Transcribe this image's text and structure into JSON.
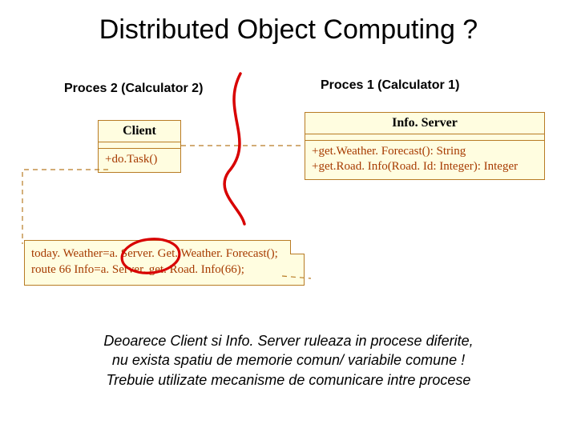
{
  "title": "Distributed Object Computing ?",
  "process2_label": "Proces 2 (Calculator 2)",
  "process1_label": "Proces 1 (Calculator 1)",
  "client": {
    "name": "Client",
    "op1": "+do.Task()"
  },
  "server": {
    "name": "Info. Server",
    "op1": "+get.Weather. Forecast(): String",
    "op2": "+get.Road. Info(Road. Id: Integer): Integer"
  },
  "note": {
    "line1": "today. Weather=a. Server. Get. Weather. Forecast();",
    "line2": "route 66 Info=a. Server. get. Road. Info(66);"
  },
  "footer": {
    "l1": "Deoarece Client si Info. Server ruleaza in procese diferite,",
    "l2": "nu exista spatiu de memorie comun/ variabile comune !",
    "l3": "Trebuie utilizate mecanisme de comunicare intre procese"
  }
}
